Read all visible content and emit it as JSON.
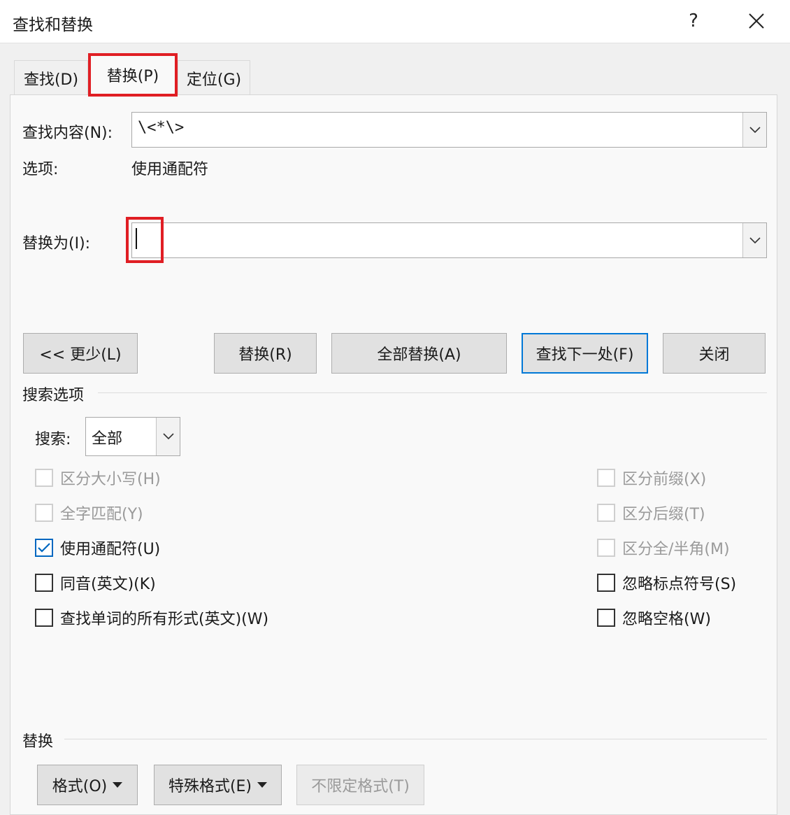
{
  "window": {
    "title": "查找和替换",
    "help": "?"
  },
  "tabs": [
    {
      "label": "查找(D)"
    },
    {
      "label": "替换(P)"
    },
    {
      "label": "定位(G)"
    }
  ],
  "find": {
    "label": "查找内容(N):",
    "value": "\\<*\\>"
  },
  "options": {
    "label": "选项:",
    "value": "使用通配符"
  },
  "replace": {
    "label": "替换为(I):",
    "value": ""
  },
  "buttons": {
    "less": "<< 更少(L)",
    "replace": "替换(R)",
    "replace_all": "全部替换(A)",
    "find_next": "查找下一处(F)",
    "close": "关闭"
  },
  "search_options": {
    "title": "搜索选项",
    "search_label": "搜索:",
    "search_value": "全部"
  },
  "checkboxes_left": [
    {
      "label": "区分大小写(H)",
      "checked": false,
      "disabled": true
    },
    {
      "label": "全字匹配(Y)",
      "checked": false,
      "disabled": true
    },
    {
      "label": "使用通配符(U)",
      "checked": true,
      "disabled": false
    },
    {
      "label": "同音(英文)(K)",
      "checked": false,
      "disabled": false
    },
    {
      "label": "查找单词的所有形式(英文)(W)",
      "checked": false,
      "disabled": false
    }
  ],
  "checkboxes_right": [
    {
      "label": "区分前缀(X)",
      "checked": false,
      "disabled": true
    },
    {
      "label": "区分后缀(T)",
      "checked": false,
      "disabled": true
    },
    {
      "label": "区分全/半角(M)",
      "checked": false,
      "disabled": true
    },
    {
      "label": "忽略标点符号(S)",
      "checked": false,
      "disabled": false
    },
    {
      "label": "忽略空格(W)",
      "checked": false,
      "disabled": false
    }
  ],
  "replace_section": {
    "title": "替换",
    "format": "格式(O)",
    "special": "特殊格式(E)",
    "no_format": "不限定格式(T)"
  },
  "colors": {
    "highlight": "#e01e24",
    "accent": "#0078d7"
  }
}
